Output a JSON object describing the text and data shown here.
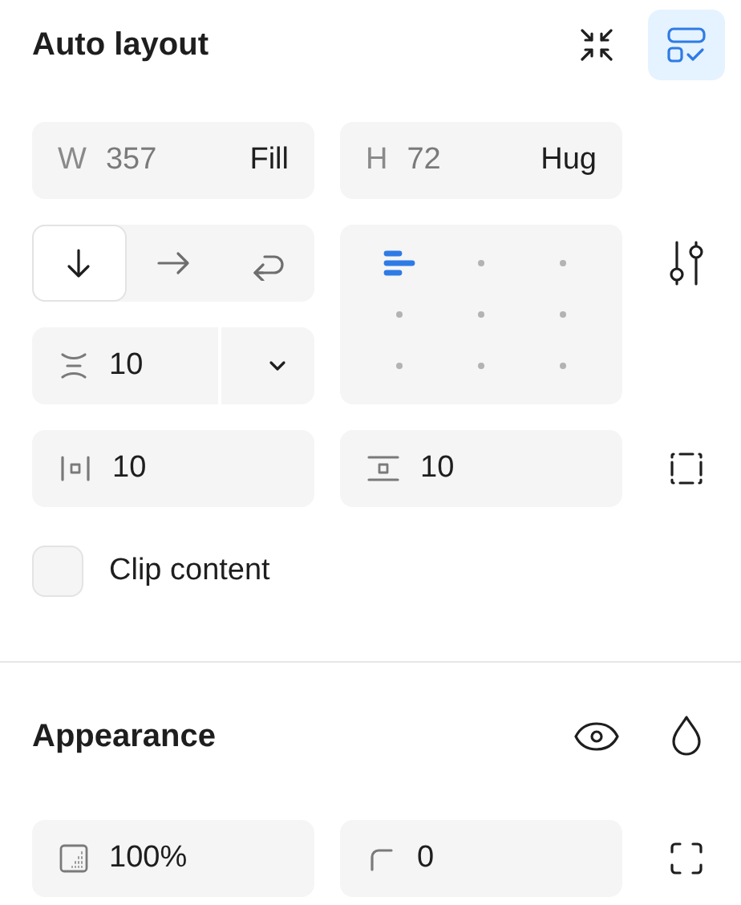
{
  "auto_layout": {
    "title": "Auto layout",
    "guide_button": {
      "selected": true
    },
    "width": {
      "label": "W",
      "value": "357",
      "mode": "Fill"
    },
    "height": {
      "label": "H",
      "value": "72",
      "mode": "Hug"
    },
    "direction": [
      {
        "kind": "vertical",
        "selected": true
      },
      {
        "kind": "horizontal",
        "selected": false
      },
      {
        "kind": "wrap",
        "selected": false
      }
    ],
    "gap": {
      "value": "10"
    },
    "alignment": [
      {
        "selected": true
      },
      {
        "selected": false
      },
      {
        "selected": false
      },
      {
        "selected": false
      },
      {
        "selected": false
      },
      {
        "selected": false
      },
      {
        "selected": false
      },
      {
        "selected": false
      },
      {
        "selected": false
      }
    ],
    "padding_horizontal": {
      "value": "10"
    },
    "padding_vertical": {
      "value": "10"
    },
    "clip_content": {
      "label": "Clip content",
      "checked": false
    }
  },
  "appearance": {
    "title": "Appearance",
    "opacity": {
      "value": "100%"
    },
    "corner_radius": {
      "value": "0"
    }
  }
}
